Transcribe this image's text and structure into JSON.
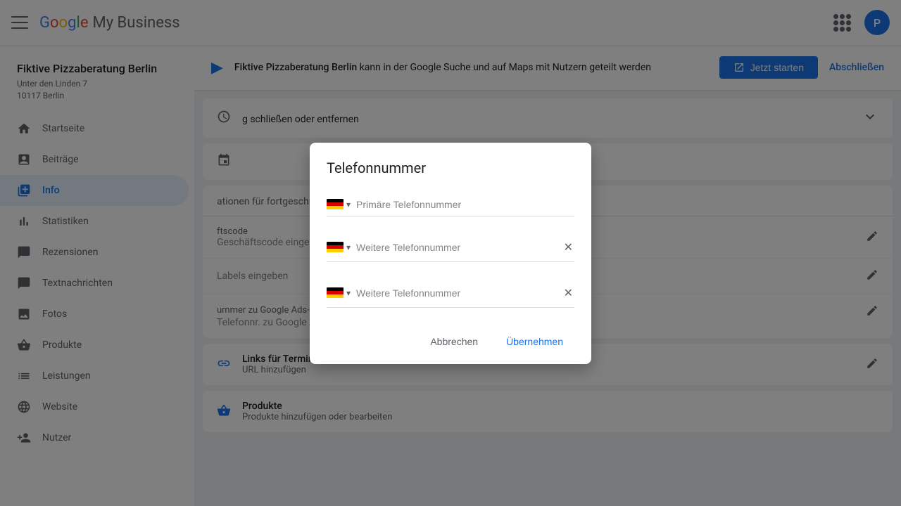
{
  "app": {
    "title": "Google My Business",
    "logo_letters": [
      "G",
      "o",
      "o",
      "g",
      "l",
      "e"
    ],
    "my_business": "My Business"
  },
  "nav": {
    "avatar_letter": "P",
    "grid_icon": "grid-icon"
  },
  "sidebar": {
    "business_name": "Fiktive Pizzaberatung Berlin",
    "business_street": "Unter den Linden 7",
    "business_city": "10117 Berlin",
    "items": [
      {
        "id": "startseite",
        "label": "Startseite",
        "icon": "home"
      },
      {
        "id": "beitraege",
        "label": "Beiträge",
        "icon": "newspaper"
      },
      {
        "id": "info",
        "label": "Info",
        "icon": "info",
        "active": true
      },
      {
        "id": "statistiken",
        "label": "Statistiken",
        "icon": "bar-chart"
      },
      {
        "id": "rezensionen",
        "label": "Rezensionen",
        "icon": "star"
      },
      {
        "id": "textnachrichten",
        "label": "Textnachrichten",
        "icon": "chat"
      },
      {
        "id": "fotos",
        "label": "Fotos",
        "icon": "photo"
      },
      {
        "id": "produkte",
        "label": "Produkte",
        "icon": "basket"
      },
      {
        "id": "leistungen",
        "label": "Leistungen",
        "icon": "list"
      },
      {
        "id": "website",
        "label": "Website",
        "icon": "web"
      },
      {
        "id": "nutzer",
        "label": "Nutzer",
        "icon": "person-add"
      }
    ]
  },
  "banner": {
    "text_pre": "",
    "business": "Fiktive Pizzaberatung Berlin",
    "text_post": " kann in der Google Suche und auf Maps mit Nutzern geteilt werden",
    "button_label": "Jetzt starten",
    "close_label": "Abschließen"
  },
  "content": {
    "section_collapse_text": "g schließen oder entfernen",
    "advanced_label": "ationen für fortgeschrittene Nutzer",
    "geschaeftscode_label": "ftscode",
    "geschaeftscode_placeholder": "Geschäftscode eingeben",
    "labels_placeholder": "Labels eingeben",
    "ads_label": "ummer zu Google Ads-Standorterweiterung",
    "ads_value": "Telefonnr. zu Google Ads-Standorterweiterung eingeben",
    "links_label": "Links für Termine",
    "links_sublabel": "URL hinzufügen",
    "produkte_label": "Produkte",
    "produkte_sublabel": "Produkte hinzufügen oder bearbeiten"
  },
  "dialog": {
    "title": "Telefonnummer",
    "primary_placeholder": "Primäre Telefonnummer",
    "secondary_placeholder": "Weitere Telefonnummer",
    "cancel_label": "Abbrechen",
    "submit_label": "Übernehmen",
    "country_code": "DE"
  }
}
